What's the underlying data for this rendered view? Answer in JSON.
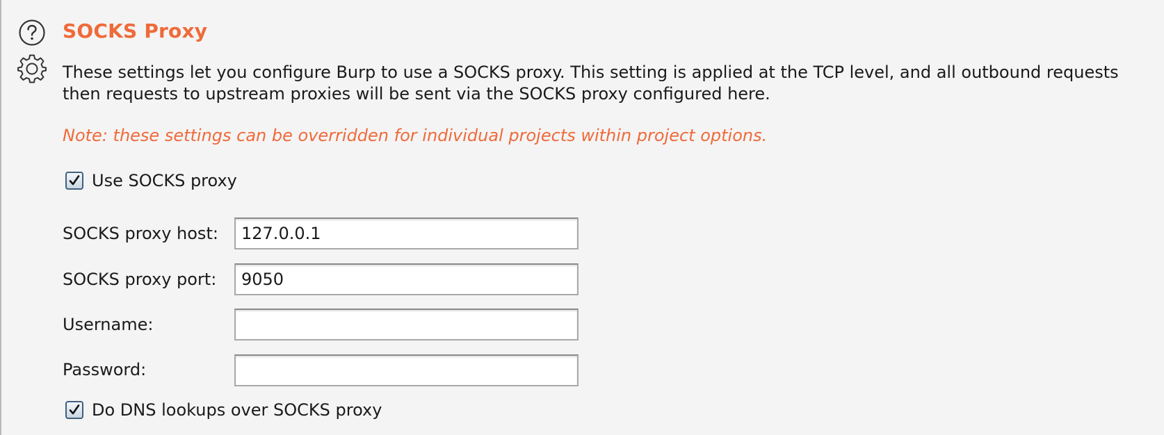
{
  "section": {
    "title": "SOCKS Proxy",
    "description_line1": "These settings let you configure Burp to use a SOCKS proxy. This setting is applied at the TCP level, and all outbound requests",
    "description_line2": "then requests to upstream proxies will be sent via the SOCKS proxy configured here.",
    "note": "Note: these settings can be overridden for individual projects within project options."
  },
  "icons": {
    "help": "help-circle-icon",
    "settings": "gear-icon",
    "checkmark": "checkmark-icon"
  },
  "options": {
    "use_socks_proxy": {
      "label": "Use SOCKS proxy",
      "checked": true
    },
    "dns_over_socks": {
      "label": "Do DNS lookups over SOCKS proxy",
      "checked": true
    }
  },
  "fields": {
    "host": {
      "label": "SOCKS proxy host:",
      "value": "127.0.0.1"
    },
    "port": {
      "label": "SOCKS proxy port:",
      "value": "9050"
    },
    "username": {
      "label": "Username:",
      "value": ""
    },
    "password": {
      "label": "Password:",
      "value": ""
    }
  },
  "colors": {
    "accent": "#ef6a3a",
    "panel_background": "#f4f4f4",
    "text": "#1a1a1a"
  }
}
